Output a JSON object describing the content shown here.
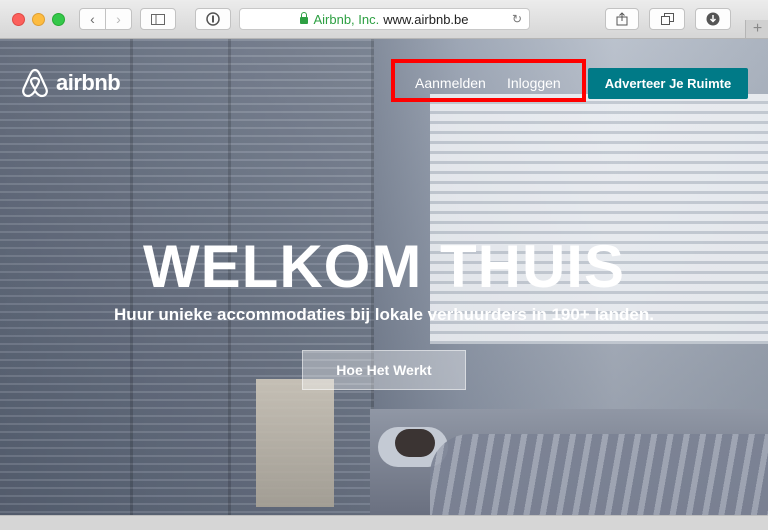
{
  "browser": {
    "url_org": "Airbnb, Inc.",
    "url_domain": "www.airbnb.be",
    "new_tab_symbol": "+",
    "icons": [
      "back-icon",
      "forward-icon",
      "sidebar-icon",
      "privacy-icon",
      "lock-icon",
      "reload-icon",
      "share-icon",
      "tabs-icon",
      "download-icon"
    ]
  },
  "site": {
    "logo_text": "airbnb",
    "nav": {
      "signup": "Aanmelden",
      "login": "Inloggen",
      "host": "Adverteer Je Ruimte"
    },
    "hero": {
      "title": "WELKOM THUIS",
      "subtitle": "Huur unieke accommodaties bij lokale verhuurders in 190+ landen.",
      "button": "Hoe Het Werkt"
    }
  },
  "colors": {
    "accent": "#007a87",
    "highlight": "#ff0000",
    "secure": "#2ea043"
  }
}
